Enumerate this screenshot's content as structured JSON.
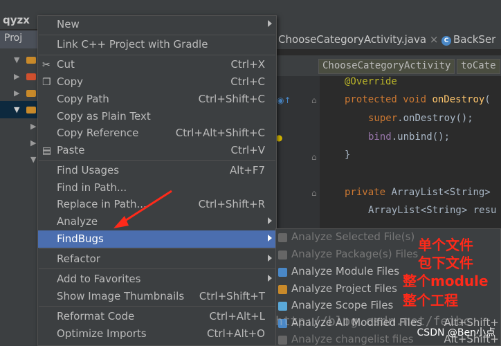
{
  "project": {
    "title": "qyzx",
    "tab_label": "Proj"
  },
  "editor": {
    "tabs": [
      {
        "label": "ChooseCategoryActivity.java"
      },
      {
        "label": "BackSer"
      }
    ],
    "breadcrumbs": [
      "ChooseCategoryActivity",
      "toCate"
    ],
    "code_lines": [
      {
        "type": "anno",
        "text": "@Override"
      },
      {
        "type": "mixed",
        "kw": "protected void ",
        "fn": "onDestroy",
        "rest": "("
      },
      {
        "type": "mixed2",
        "kw": "super",
        "rest": ".onDestroy();"
      },
      {
        "type": "mixed3",
        "fld": "bind",
        "rest": ".unbind();"
      },
      {
        "type": "plain",
        "text": "}"
      },
      {
        "type": "mixed4",
        "kw": "private ",
        "rest": "ArrayList<String> "
      },
      {
        "type": "plain",
        "text": "ArrayList<String> resu"
      }
    ]
  },
  "context_menu": {
    "items": [
      {
        "label": "New",
        "shortcut": "",
        "submenu": true,
        "icon": ""
      },
      {
        "label": "Link C++ Project with Gradle",
        "shortcut": "",
        "submenu": false,
        "icon": ""
      },
      {
        "label": "Cut",
        "shortcut": "Ctrl+X",
        "submenu": false,
        "icon": "scissors-icon"
      },
      {
        "label": "Copy",
        "shortcut": "Ctrl+C",
        "submenu": false,
        "icon": "copy-icon"
      },
      {
        "label": "Copy Path",
        "shortcut": "Ctrl+Shift+C",
        "submenu": false,
        "icon": ""
      },
      {
        "label": "Copy as Plain Text",
        "shortcut": "",
        "submenu": false,
        "icon": ""
      },
      {
        "label": "Copy Reference",
        "shortcut": "Ctrl+Alt+Shift+C",
        "submenu": false,
        "icon": ""
      },
      {
        "label": "Paste",
        "shortcut": "Ctrl+V",
        "submenu": false,
        "icon": "paste-icon"
      },
      {
        "label": "Find Usages",
        "shortcut": "Alt+F7",
        "submenu": false,
        "icon": ""
      },
      {
        "label": "Find in Path...",
        "shortcut": "",
        "submenu": false,
        "icon": ""
      },
      {
        "label": "Replace in Path...",
        "shortcut": "Ctrl+Shift+R",
        "submenu": false,
        "icon": ""
      },
      {
        "label": "Analyze",
        "shortcut": "",
        "submenu": true,
        "icon": ""
      },
      {
        "label": "FindBugs",
        "shortcut": "",
        "submenu": true,
        "icon": "",
        "highlighted": true
      },
      {
        "label": "Refactor",
        "shortcut": "",
        "submenu": true,
        "icon": ""
      },
      {
        "label": "Add to Favorites",
        "shortcut": "",
        "submenu": true,
        "icon": ""
      },
      {
        "label": "Show Image Thumbnails",
        "shortcut": "Ctrl+Shift+T",
        "submenu": false,
        "icon": ""
      },
      {
        "label": "Reformat Code",
        "shortcut": "Ctrl+Alt+L",
        "submenu": false,
        "icon": ""
      },
      {
        "label": "Optimize Imports",
        "shortcut": "Ctrl+Alt+O",
        "submenu": false,
        "icon": ""
      }
    ]
  },
  "findbugs_submenu": {
    "items": [
      {
        "label": "Analyze Selected File(s)",
        "shortcut": "",
        "disabled": true
      },
      {
        "label": "Analyze Package(s) Files",
        "shortcut": "",
        "disabled": true
      },
      {
        "label": "Analyze Module Files",
        "shortcut": "",
        "disabled": false
      },
      {
        "label": "Analyze Project Files",
        "shortcut": "",
        "disabled": false
      },
      {
        "label": "Analyze Scope Files",
        "shortcut": "",
        "disabled": false
      },
      {
        "label": "Analyze All Modified Files",
        "shortcut": "Alt+Shift+",
        "disabled": false
      },
      {
        "label": "Analyze changelist files",
        "shortcut": "Alt+Shift+",
        "disabled": true
      }
    ]
  },
  "annotations": {
    "notes": [
      "单个文件",
      "包下文件",
      "整个module",
      "整个工程"
    ],
    "watermark": "http://blog.csdn.net/feibc",
    "credit": "CSDN @Ben小点"
  },
  "colors": {
    "annotation_red": "#ff2a1a",
    "highlight_blue": "#4b6eaf",
    "menu_bg": "#3c3f41"
  }
}
